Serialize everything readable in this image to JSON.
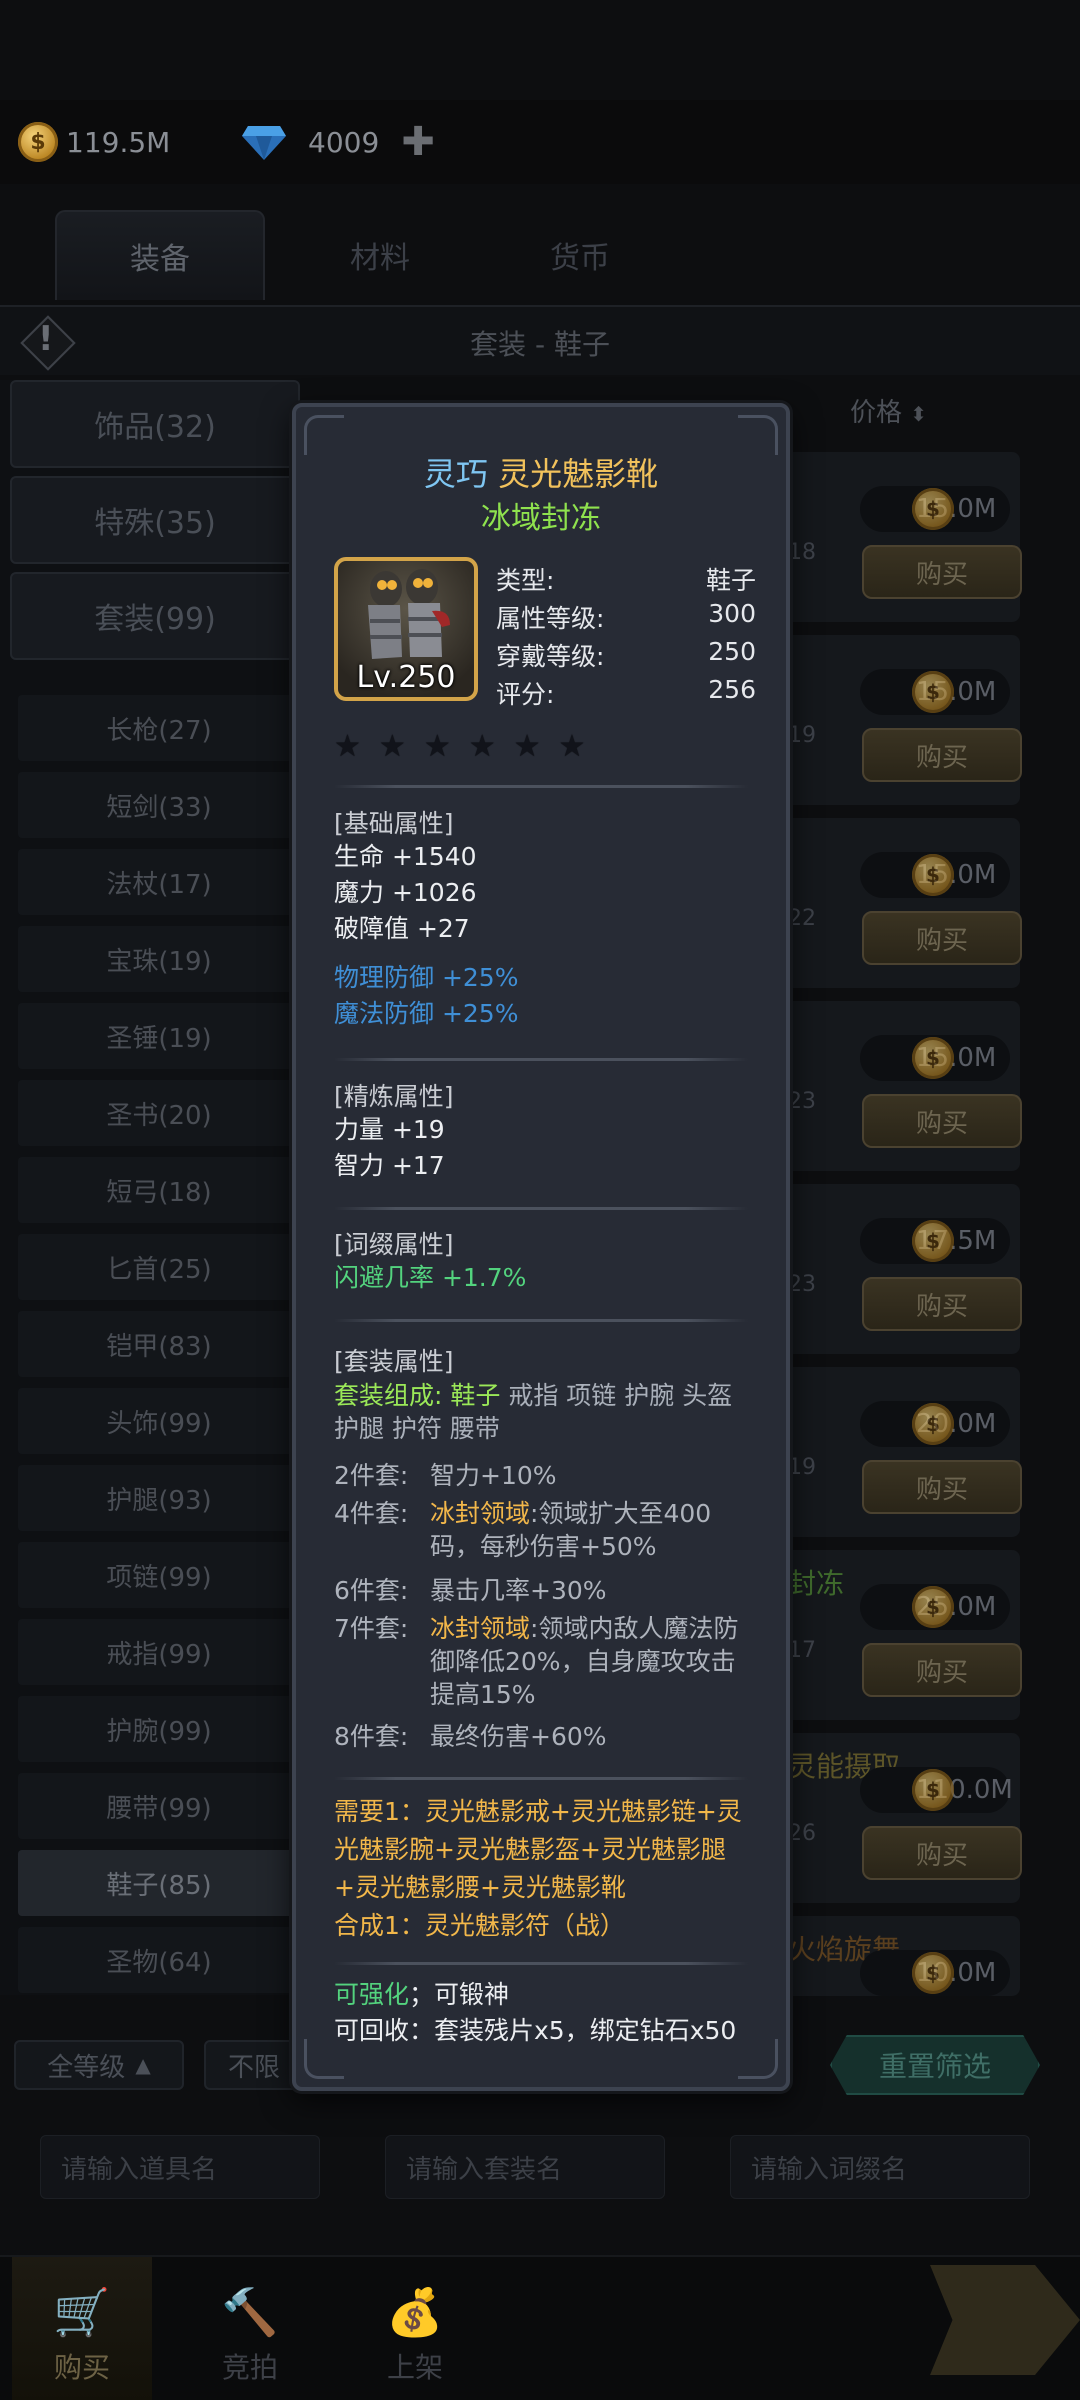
{
  "currency": {
    "gold": "119.5M",
    "diamond": "4009"
  },
  "tabs": [
    "装备",
    "材料",
    "货币"
  ],
  "title": "套装 - 鞋子",
  "categories": [
    "饰品(32)",
    "特殊(35)",
    "套装(99)"
  ],
  "subcategories": [
    "长枪(27)",
    "短剑(33)",
    "法杖(17)",
    "宝珠(19)",
    "圣锤(19)",
    "圣书(20)",
    "短弓(18)",
    "匕首(25)",
    "铠甲(83)",
    "头饰(99)",
    "护腿(93)",
    "项链(99)",
    "戒指(99)",
    "护腕(99)",
    "腰带(99)",
    "鞋子(85)",
    "圣物(64)"
  ],
  "list": {
    "price_header": "价格",
    "rows": [
      {
        "name_frag": "",
        "sub": "18",
        "price": "15.0M",
        "buy": "购买"
      },
      {
        "name_frag": "",
        "sub": "19",
        "price": "15.0M",
        "buy": "购买"
      },
      {
        "name_frag": "",
        "sub": "22",
        "price": "15.0M",
        "buy": "购买"
      },
      {
        "name_frag": "",
        "sub": "23",
        "price": "15.0M",
        "buy": "购买"
      },
      {
        "name_frag": "",
        "sub": "23",
        "price": "17.5M",
        "buy": "购买"
      },
      {
        "name_frag": "",
        "sub": "19",
        "price": "20.0M",
        "buy": "购买"
      },
      {
        "name_frag": "封冻",
        "sub": "17",
        "price": "25.0M",
        "buy": "购买"
      },
      {
        "name_frag": "灵能摄取",
        "sub": "26",
        "price": "110.0M",
        "buy": "购买"
      },
      {
        "name_frag": "火焰旋舞",
        "sub": "",
        "price": "10.0M",
        "buy": ""
      }
    ]
  },
  "filters": {
    "level": "全等级",
    "limit": "不限",
    "reset": "重置筛选"
  },
  "search": {
    "item": "请输入道具名",
    "set": "请输入套装名",
    "affix": "请输入词缀名"
  },
  "nav": [
    "购买",
    "竞拍",
    "上架"
  ],
  "tooltip": {
    "quality": "灵巧",
    "name": "灵光魅影靴",
    "set_name": "冰域封冻",
    "level": "Lv.250",
    "info": [
      {
        "k": "类型:",
        "v": "鞋子"
      },
      {
        "k": "属性等级:",
        "v": "300"
      },
      {
        "k": "穿戴等级:",
        "v": "250"
      },
      {
        "k": "评分:",
        "v": "256"
      }
    ],
    "stars": 0,
    "star_total": 6,
    "basic_title": "[基础属性]",
    "basic": [
      "生命 +1540",
      "魔力 +1026",
      "破障值 +27"
    ],
    "basic_blue": [
      "物理防御 +25%",
      "魔法防御 +25%"
    ],
    "refine_title": "[精炼属性]",
    "refine": [
      "力量 +19",
      "智力 +17"
    ],
    "affix_title": "[词缀属性]",
    "affix": [
      "闪避几率 +1.7%"
    ],
    "set_title": "[套装属性]",
    "set_comp_label": "套装组成:",
    "set_comp_current": "鞋子",
    "set_comp_rest": " 戒指 项链 护腕 头盔 护腿 护符 腰带",
    "set_bonus": [
      {
        "label": "2件套:",
        "skill": "",
        "text": "智力+10%"
      },
      {
        "label": "4件套:",
        "skill": "冰封领域",
        "text": ":领域扩大至400码，每秒伤害+50%"
      },
      {
        "label": "6件套:",
        "skill": "",
        "text": "暴击几率+30%"
      },
      {
        "label": "7件套:",
        "skill": "冰封领域",
        "text": ":领域内敌人魔法防御降低20%，自身魔攻攻击提高15%"
      },
      {
        "label": "8件套:",
        "skill": "",
        "text": "最终伤害+60%"
      }
    ],
    "require": "需要1：灵光魅影戒+灵光魅影链+灵光魅影腕+灵光魅影盔+灵光魅影腿+灵光魅影腰+灵光魅影靴",
    "compose": "合成1：灵光魅影符（战）",
    "upgradable": "可强化",
    "forgeable": "；可锻神",
    "recycle": "可回收：套装残片x5，绑定钻石x50"
  },
  "colors": {
    "quality": "#7fc6f2",
    "name": "#f2c25c",
    "set": "#8fe24e",
    "blue_stat": "#3f8fd6",
    "green_stat": "#53d37e",
    "require": "#f2b74a"
  }
}
